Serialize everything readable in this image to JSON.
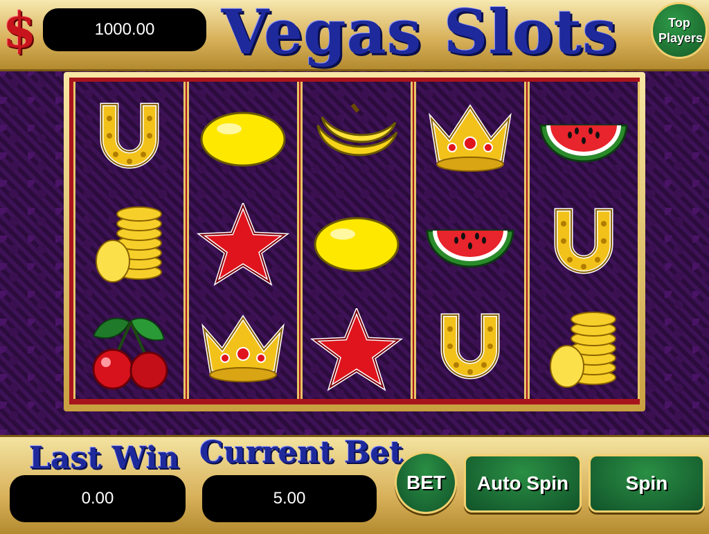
{
  "header": {
    "currency_symbol": "$",
    "balance": "1000.00",
    "title": "Vegas Slots",
    "top_players_label": "Top Players"
  },
  "reels": [
    [
      "horseshoe",
      "coins",
      "cherry"
    ],
    [
      "lemon",
      "star",
      "crown"
    ],
    [
      "banana",
      "lemon",
      "star"
    ],
    [
      "crown",
      "watermelon",
      "horseshoe"
    ],
    [
      "watermelon",
      "horseshoe",
      "coins"
    ]
  ],
  "footer": {
    "last_win_label": "Last Win",
    "last_win_value": "0.00",
    "current_bet_label": "Current Bet",
    "current_bet_value": "5.00",
    "bet_button": "BET",
    "auto_spin_button": "Auto Spin",
    "spin_button": "Spin"
  },
  "colors": {
    "title_blue": "#1e2a9c",
    "button_green": "#1f7a38",
    "reel_frame_red": "#a8141c",
    "gold": "#d9b25c"
  }
}
